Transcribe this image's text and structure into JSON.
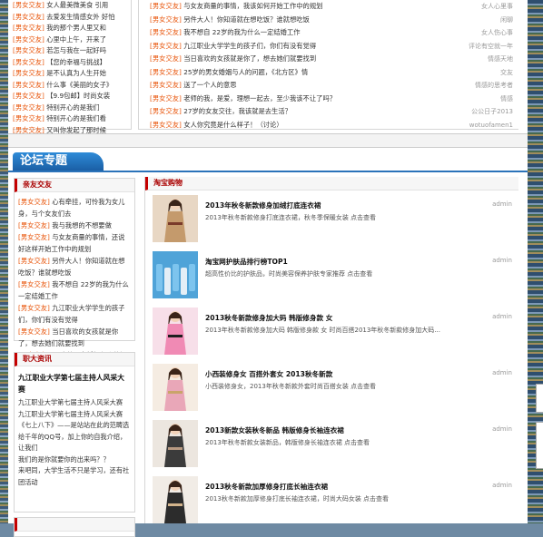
{
  "colors": {
    "accent": "#2b73b9",
    "tag": "#e8540a",
    "section_red": "#c40000"
  },
  "top_left_list": [
    {
      "tag": "[男女交友]",
      "text": "女人最美微美食 引用"
    },
    {
      "tag": "[男女交友]",
      "text": "去爱发生情感女外 好怕"
    },
    {
      "tag": "[男女交友]",
      "text": "我的那个男人里又和"
    },
    {
      "tag": "[男女交友]",
      "text": "心里中上午，开来了"
    },
    {
      "tag": "[男女交友]",
      "text": "若怎与我在一起好吗"
    },
    {
      "tag": "[男女交友]",
      "text": "【您的幸福与挑战】"
    },
    {
      "tag": "[男女交友]",
      "text": "是不认真为人生开始"
    },
    {
      "tag": "[男女交友]",
      "text": "什么事《美丽的女子》"
    },
    {
      "tag": "[男女交友]",
      "text": "【9.9包邮】时尚女装"
    },
    {
      "tag": "[男女交友]",
      "text": "特别开心的是我们"
    },
    {
      "tag": "[男女交友]",
      "text": "特别开心的是我们看"
    },
    {
      "tag": "[男女交友]",
      "text": "又叫你发起了那时候"
    }
  ],
  "top_right_list": [
    {
      "tag": "[男女交友]",
      "text": "与女友商量的事情，我该如何开始工作中的规划",
      "meta": "女人心里事"
    },
    {
      "tag": "[男女交友]",
      "text": "另件大人！你知道就在想吃饭？谁就想吃饭",
      "meta": "闲聊"
    },
    {
      "tag": "[男女交友]",
      "text": "我不想自 22岁的我为什么一定结婚工作",
      "meta": "女人伤心事"
    },
    {
      "tag": "[男女交友]",
      "text": "九江职业大学学生的孩子们，你们有没有觉得",
      "meta": "评论有空就一年"
    },
    {
      "tag": "[男女交友]",
      "text": "当日喜欢的女孩就是你了，想去她们就要找到",
      "meta": "情感天地"
    },
    {
      "tag": "[男女交友]",
      "text": "25岁的男女婚姻与人的问题，《北方区》情",
      "meta": "交友"
    },
    {
      "tag": "[男女交友]",
      "text": "送了一个人的意思",
      "meta": "情感的思考者"
    },
    {
      "tag": "[男女交友]",
      "text": "老师的我，是爱，理想一起去，至少我该不让了吗？",
      "meta": "情感"
    },
    {
      "tag": "[男女交友]",
      "text": "27岁的女友交往，我该就是去生活？",
      "meta": "公公日子2013"
    },
    {
      "tag": "[男女交友]",
      "text": "女人你究竟是什么样子！（讨论）",
      "meta": "wotuofamen1"
    }
  ],
  "section_title": "论坛专题",
  "left_box1": {
    "title": "亲友交友",
    "lines": [
      {
        "tag": "[男女交友]",
        "text": "心有牵挂，可怜我为女儿身，与个女友们去"
      },
      {
        "tag": "[男女交友]",
        "text": "我与我想的不想要做"
      },
      {
        "tag": "[男女交友]",
        "text": "与女友商量的事情，还说好这样开始工作中的规划"
      },
      {
        "tag": "[男女交友]",
        "text": "另件大人！你知道就在想吃饭？谁就想吃饭"
      },
      {
        "tag": "[男女交友]",
        "text": "我不想自 22岁的我为什么一定结婚工作"
      },
      {
        "tag": "[男女交友]",
        "text": "九江职业大学学生的孩子们，你们有没有觉得"
      },
      {
        "tag": "[男女交友]",
        "text": "当日喜欢的女孩就是你了，想去她们就要找到"
      },
      {
        "tag": "[男女交友]",
        "text": "25岁的男女婚姻与人的问题，《北方区》情"
      }
    ]
  },
  "left_box2": {
    "title": "职大资讯",
    "feature_title": "九江职业大学第七届主持人风采大赛",
    "lines": [
      "九江职业大学第七届主持人风采大赛",
      "九江职业大学第七届主持人风采大赛《七上八下》——是站站在此的范畴选",
      "给千年的QQ号，加上你的自我介绍，让我们",
      "我们的是你就要你的出来吗？？",
      "来吧同，大学生活不只是学习，还有社团活动"
    ]
  },
  "right_box": {
    "title": "淘宝购物",
    "items": [
      {
        "title": "2013年秋冬新款修身加绒打底连衣裙",
        "desc": "2013年秋冬新款修身打底连衣裙，秋冬季保暖女装 点击查看",
        "user": "admin"
      },
      {
        "title": "淘宝网护肤品排行榜TOP1",
        "desc": "超高性价比的护肤品，时尚美容保养护肤专家推荐 点击查看",
        "user": "admin"
      },
      {
        "title": "2013秋冬新款修身加大码 韩版修身款 女",
        "desc": "2013年秋冬新款修身加大码 韩版修身款 女 时尚百搭2013年秋冬新款修身加大码...",
        "user": "admin"
      },
      {
        "title": "小西装修身女 百搭外套女 2013秋冬新款",
        "desc": "小西装修身女，2013年秋冬新款外套时尚百搭女装 点击查看",
        "user": "admin"
      },
      {
        "title": "2013新款女装秋冬新品 韩版修身长袖连衣裙",
        "desc": "2013年秋冬新款女装新品，韩版修身长袖连衣裙 点击查看",
        "user": "admin"
      },
      {
        "title": "2013秋冬新款加厚修身打底长袖连衣裙",
        "desc": "2013秋冬新款加厚修身打底长袖连衣裙，时尚大码女装 点击查看",
        "user": "admin"
      }
    ]
  }
}
